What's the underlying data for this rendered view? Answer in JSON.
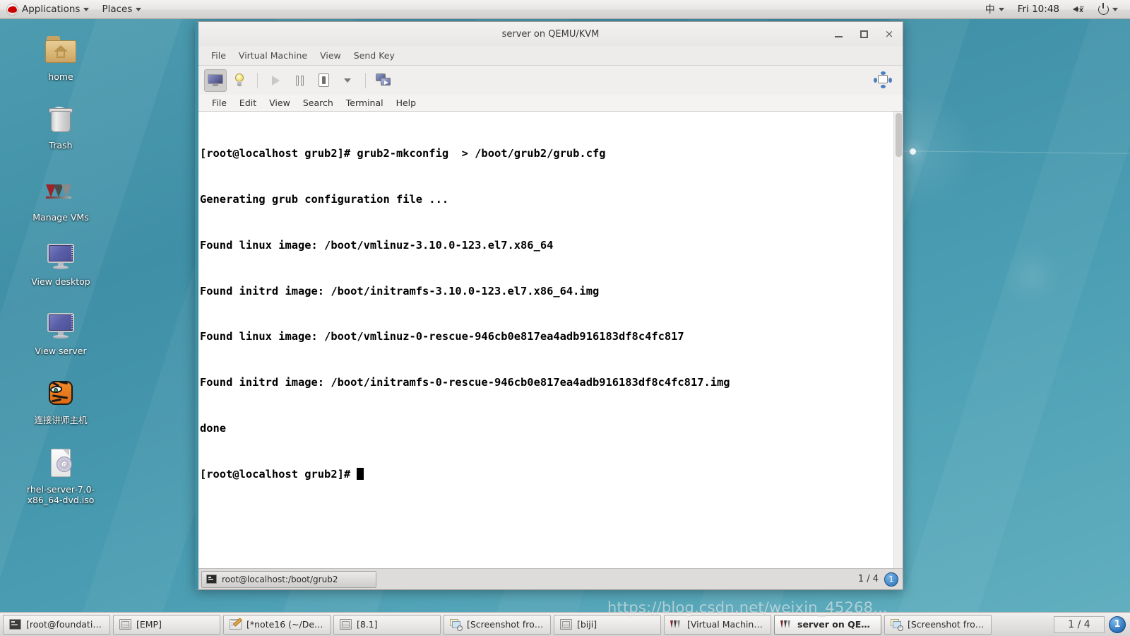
{
  "top_panel": {
    "logo_icon": "redhat-logo-icon",
    "applications_label": "Applications",
    "places_label": "Places",
    "ime_label": "中",
    "clock": "Fri 10:48",
    "volume_icon": "volume-muted-icon",
    "power_icon": "power-icon"
  },
  "desktop_icons": [
    {
      "label": "home",
      "icon": "home-folder-icon"
    },
    {
      "label": "Trash",
      "icon": "trash-icon"
    },
    {
      "label": "Manage VMs",
      "icon": "virt-manager-icon"
    },
    {
      "label": "View desktop",
      "icon": "monitor-icon"
    },
    {
      "label": "View server",
      "icon": "monitor-icon"
    },
    {
      "label": "连接讲师主机",
      "icon": "tigervnc-icon"
    },
    {
      "label": "rhel-server-7.0-x86_64-dvd.iso",
      "icon": "iso-disc-icon"
    }
  ],
  "vm_window": {
    "title": "server on QEMU/KVM",
    "window_buttons": {
      "minimize": "minimize-button",
      "maximize": "maximize-button",
      "close": "×"
    },
    "menus": [
      "File",
      "Virtual Machine",
      "View",
      "Send Key"
    ],
    "toolbar": [
      {
        "name": "console-view-button",
        "icon": "monitor-icon",
        "state": "active"
      },
      {
        "name": "show-details-button",
        "icon": "lightbulb-icon",
        "state": "normal"
      },
      {
        "name": "run-button",
        "icon": "play-icon",
        "state": "disabled"
      },
      {
        "name": "pause-button",
        "icon": "pause-icon",
        "state": "normal"
      },
      {
        "name": "shutdown-button",
        "icon": "shutdown-icon",
        "state": "normal"
      },
      {
        "name": "shutdown-menu-button",
        "icon": "chevron-down-icon",
        "state": "normal"
      },
      {
        "name": "snapshots-button",
        "icon": "screens-icon",
        "state": "normal"
      }
    ],
    "pin_widget_icon": "drag-handle-icon"
  },
  "guest_terminal": {
    "menus": [
      "File",
      "Edit",
      "View",
      "Search",
      "Terminal",
      "Help"
    ],
    "lines": [
      "[root@localhost grub2]# grub2-mkconfig  > /boot/grub2/grub.cfg",
      "Generating grub configuration file ...",
      "Found linux image: /boot/vmlinuz-3.10.0-123.el7.x86_64",
      "Found initrd image: /boot/initramfs-3.10.0-123.el7.x86_64.img",
      "Found linux image: /boot/vmlinuz-0-rescue-946cb0e817ea4adb916183df8c4fc817",
      "Found initrd image: /boot/initramfs-0-rescue-946cb0e817ea4adb916183df8c4fc817.img",
      "done"
    ],
    "prompt": "[root@localhost grub2]# ",
    "fg_color": "#000000",
    "bg_color": "#ffffff"
  },
  "vm_statusbar": {
    "task_label": "root@localhost:/boot/grub2",
    "task_icon": "terminal-icon",
    "workspace_indicator": "1 / 4",
    "workspace_circle": "1"
  },
  "taskbar": {
    "items": [
      {
        "label": "[root@foundation...",
        "icon": "terminal-icon",
        "active": false
      },
      {
        "label": "[EMP]",
        "icon": "file-manager-icon",
        "active": false
      },
      {
        "label": "[*note16 (~/Desk...",
        "icon": "text-editor-icon",
        "active": false
      },
      {
        "label": "[8.1]",
        "icon": "file-manager-icon",
        "active": false
      },
      {
        "label": "[Screenshot from ...",
        "icon": "screenshot-icon",
        "active": false
      },
      {
        "label": "[biji]",
        "icon": "file-manager-icon",
        "active": false
      },
      {
        "label": "[Virtual Machine ...",
        "icon": "virt-manager-icon",
        "active": false
      },
      {
        "label": "server on QEMU/K...",
        "icon": "virt-manager-icon",
        "active": true
      },
      {
        "label": "[Screenshot from ...",
        "icon": "screenshot-icon",
        "active": false
      }
    ],
    "workspace_indicator": "1 / 4",
    "workspace_circle": "1"
  },
  "watermark": {
    "text": "https://blog.csdn.net/weixin_45268..."
  },
  "colors": {
    "desktop_teal": "#4a9db2",
    "window_accent": "#3e8fa3",
    "panel_grey": "#e4e2e0",
    "terminal_bg": "#ffffff",
    "terminal_fg": "#000000"
  }
}
